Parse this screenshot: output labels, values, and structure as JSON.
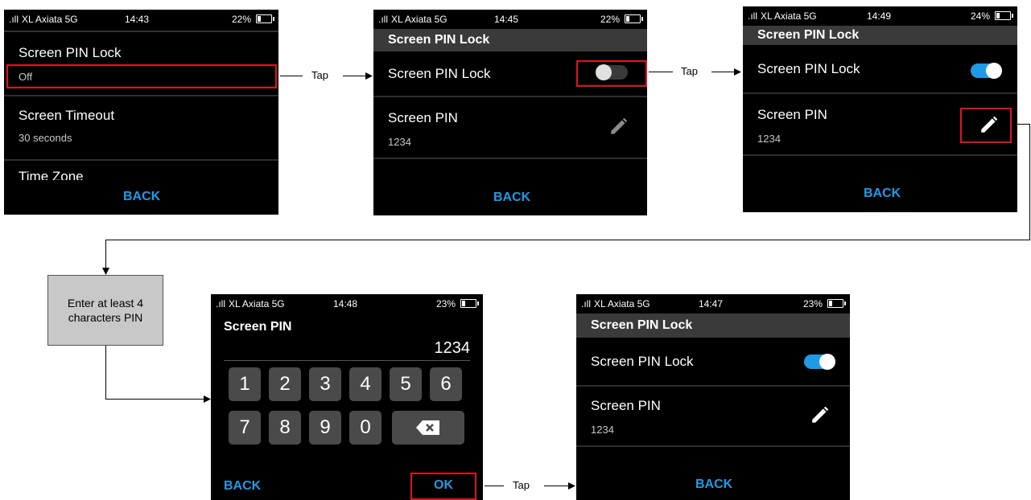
{
  "status": {
    "carrier": "XL Axiata 5G",
    "s1": {
      "time": "14:43",
      "battery": "22%"
    },
    "s2": {
      "time": "14:45",
      "battery": "22%"
    },
    "s3": {
      "time": "14:49",
      "battery": "24%"
    },
    "s4": {
      "time": "14:48",
      "battery": "23%"
    },
    "s5": {
      "time": "14:47",
      "battery": "23%"
    }
  },
  "screen1": {
    "items": [
      {
        "title": "Screen PIN Lock",
        "value": "Off"
      },
      {
        "title": "Screen Timeout",
        "value": "30 seconds"
      },
      {
        "title": "Time Zone"
      }
    ],
    "back": "BACK"
  },
  "screen2": {
    "header": "Screen PIN Lock",
    "lock_label": "Screen PIN Lock",
    "lock_on": false,
    "pin_label": "Screen PIN",
    "pin_value": "1234",
    "back": "BACK"
  },
  "screen3": {
    "header": "Screen PIN Lock",
    "lock_label": "Screen PIN Lock",
    "lock_on": true,
    "pin_label": "Screen PIN",
    "pin_value": "1234",
    "back": "BACK"
  },
  "screen4": {
    "header": "Screen PIN",
    "entry_value": "1234",
    "keys": [
      "1",
      "2",
      "3",
      "4",
      "5",
      "6",
      "7",
      "8",
      "9",
      "0"
    ],
    "back": "BACK",
    "ok": "OK"
  },
  "screen5": {
    "header": "Screen PIN Lock",
    "lock_label": "Screen PIN Lock",
    "lock_on": true,
    "pin_label": "Screen PIN",
    "pin_value": "1234",
    "back": "BACK"
  },
  "flow": {
    "tap": "Tap",
    "note": "Enter at least 4 characters PIN"
  },
  "colors": {
    "accent": "#1e9be6",
    "highlight": "#e0141c"
  }
}
